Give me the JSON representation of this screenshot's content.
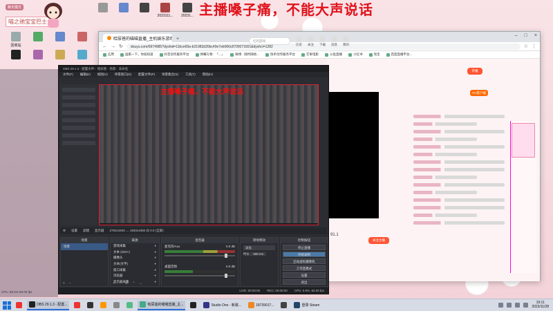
{
  "overlay_banner": "主播嗓子痛，不能大声说话",
  "watermark": {
    "title": "聊天模式",
    "subtitle": "喵之驰宝宝巴士"
  },
  "desktop_icons": [
    {
      "label": "回收站",
      "color": "#9aa"
    },
    {
      "label": "",
      "color": "#5a6"
    },
    {
      "label": "",
      "color": "#68c"
    },
    {
      "label": "",
      "color": "#c66"
    },
    {
      "label": "",
      "color": "#a6a"
    },
    {
      "label": "",
      "color": "#ca5"
    },
    {
      "label": "20231...",
      "color": "#999"
    },
    {
      "label": "2023111...",
      "color": "#a44"
    },
    {
      "label": "20231...",
      "color": "#444"
    },
    {
      "label": "20231...",
      "color": "#666"
    }
  ],
  "browser": {
    "tab_title": "哈尿爸的喵喵直播_主机娱乐游戏 | ",
    "url": "douyu.com/6974985?dyshid=11bce69a-b31983d26bc49e7eb066c8700071601&dyshci=1282",
    "bookmarks": [
      "应用",
      "国家一下，你就知道",
      "抖音创作服务平台",
      "弹幕礼物 · 「...」",
      "微博 - 随时随地...",
      "快手创作服务平台",
      "芒果电影",
      "斗鱼直播",
      "小红书",
      "淘宝",
      "百度直播平台..."
    ],
    "search_placeholder": "吃鸡游戏",
    "nav_items": [
      "历史",
      "关注",
      "下载",
      "消息",
      "我的"
    ],
    "open_live": "开播",
    "follow_btn": "关注主播",
    "score": "91.1",
    "tag": "PC客户端"
  },
  "obs": {
    "title": "OBS 29.1.3 - 配置文件：哈尿爸 - 场景：未命名",
    "menu": [
      "文件(F)",
      "编辑(E)",
      "视图(V)",
      "停靠窗口(D)",
      "配置文件(P)",
      "场景集合(S)",
      "工具(T)",
      "帮助(H)"
    ],
    "preview_bar": [
      "设置",
      "滤镜",
      "显示器",
      "2702x1920 → 1920x1080 @ 0.0 (全屏)"
    ],
    "docks": {
      "scenes": "场景",
      "sources": "来源",
      "mixer": "混音器",
      "transitions": "转场特效",
      "controls": "控制按钮"
    },
    "scenes": [
      "场景"
    ],
    "sources": [
      "游戏采集",
      "文本 (GDI+)",
      "摄像头",
      "文本(文字)",
      "窗口采集",
      "浏览器",
      "显示器采集"
    ],
    "mixer": [
      {
        "name": "麦克风/Aux",
        "level": "0.0 dB"
      },
      {
        "name": "桌面音频",
        "level": "0.0 dB"
      }
    ],
    "transition": {
      "type": "淡化",
      "duration_label": "时长",
      "duration": "300 ms"
    },
    "controls": [
      "停止直播",
      "开始录制",
      "启动虚拟摄像机",
      "工作室模式",
      "设置",
      "退出"
    ],
    "status": [
      "LIVE: 00:00:00",
      "REC: 00:00:00",
      "CPU: 0.9%, 60.00 fps"
    ]
  },
  "ghost_status": "CPU: 85.5%  60.00 fps",
  "taskbar": {
    "items": [
      {
        "label": "",
        "color": "#e33"
      },
      {
        "label": "OBS 29.1.3 - 配置...",
        "color": "#222"
      },
      {
        "label": "",
        "color": "#e33"
      },
      {
        "label": "",
        "color": "#333"
      },
      {
        "label": "",
        "color": "#f90"
      },
      {
        "label": "",
        "color": "#888"
      },
      {
        "label": "",
        "color": "#5b8"
      },
      {
        "label": "哈尿爸的喵喵直播_主...",
        "color": "#4a8"
      },
      {
        "label": "",
        "color": "#222"
      },
      {
        "label": "Studio One - 新歌...",
        "color": "#338"
      },
      {
        "label": "18739017...",
        "color": "#e82"
      },
      {
        "label": "",
        "color": "#444"
      },
      {
        "label": "登录 Steam",
        "color": "#246"
      }
    ],
    "time": "19:11",
    "date": "2023/11/28"
  }
}
